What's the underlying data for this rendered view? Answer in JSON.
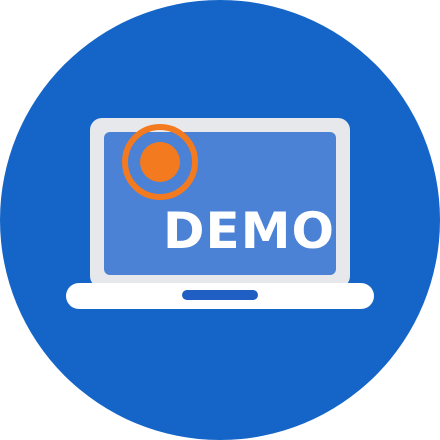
{
  "icon": {
    "name": "demo-laptop-icon",
    "label": "DEMO",
    "colors": {
      "background_circle": "#1565C8",
      "laptop_frame": "#E6E8EB",
      "screen": "#4B82D6",
      "base": "#FFFFFF",
      "trackpad": "#1F5FC4",
      "record_ring": "#F47A1F",
      "record_dot": "#F47A1F",
      "label_text": "#FFFFFF"
    }
  }
}
